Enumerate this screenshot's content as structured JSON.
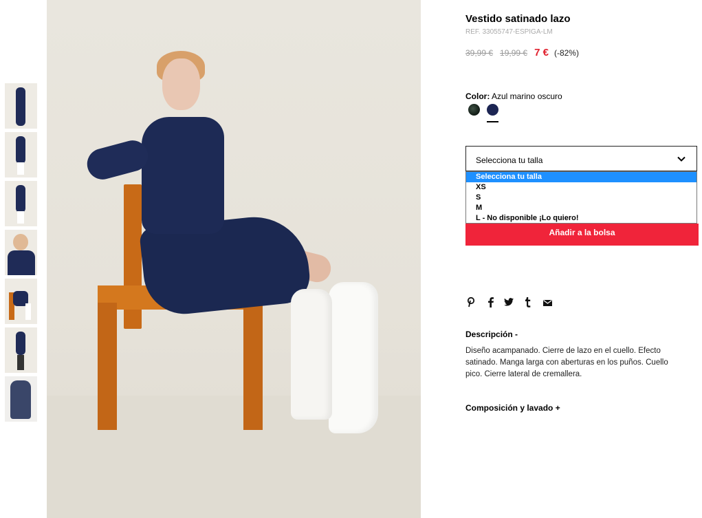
{
  "product": {
    "title": "Vestido satinado lazo",
    "ref": "REF. 33055747-ESPIGA-LM",
    "prices": {
      "original": "39,99 €",
      "previous": "19,99 €",
      "current": "7 €",
      "discount": "(-82%)"
    },
    "color_label": "Color:",
    "color_value": "Azul marino oscuro",
    "swatches": [
      {
        "name": "dark-green",
        "color": "#1a2a20"
      },
      {
        "name": "navy",
        "color": "#1c2553",
        "selected": true
      }
    ]
  },
  "size_select": {
    "value": "Selecciona tu talla",
    "options": [
      "Selecciona tu talla",
      "XS",
      "S",
      "M",
      "L - No disponible ¡Lo quiero!"
    ],
    "highlighted_index": 0
  },
  "add_button": "Añadir a la bolsa",
  "share_icons": [
    "pinterest-icon",
    "facebook-icon",
    "twitter-icon",
    "tumblr-icon",
    "email-icon"
  ],
  "description": {
    "heading": "Descripción -",
    "text": "Diseño acampanado. Cierre de lazo en el cuello. Efecto satinado. Manga larga con aberturas en los puños. Cuello pico. Cierre lateral de cremallera."
  },
  "composition": {
    "heading": "Composición y lavado +"
  },
  "colors": {
    "accent": "#f0243a",
    "price_red": "#e1222f",
    "highlight": "#1e90ff"
  }
}
